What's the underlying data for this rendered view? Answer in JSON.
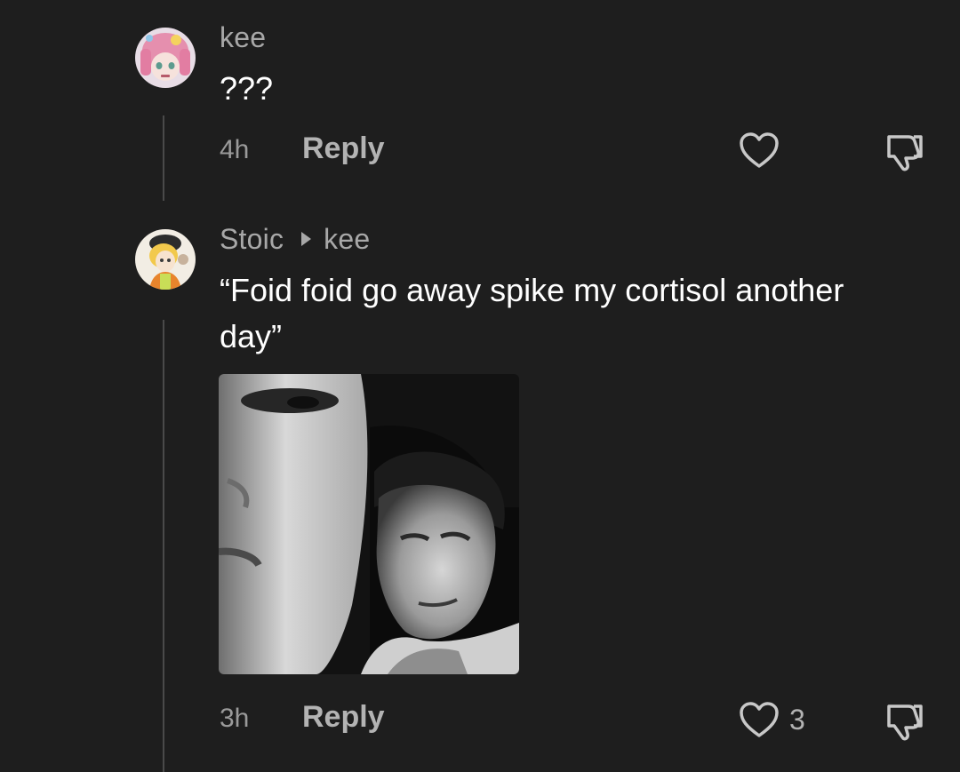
{
  "comments": [
    {
      "username": "kee",
      "text": "???",
      "time": "4h",
      "reply_label": "Reply",
      "like_count": ""
    },
    {
      "username": "Stoic",
      "reply_to": "kee",
      "text": "“Foid foid go away spike my cortisol another day”",
      "time": "3h",
      "reply_label": "Reply",
      "like_count": "3"
    }
  ],
  "icons": {
    "like": "heart-outline-icon",
    "dislike": "thumbs-down-icon",
    "reply_to": "play-triangle-icon"
  },
  "colors": {
    "background": "#1e1e1e",
    "text_primary": "#ffffff",
    "text_secondary": "#a8a8a8"
  }
}
